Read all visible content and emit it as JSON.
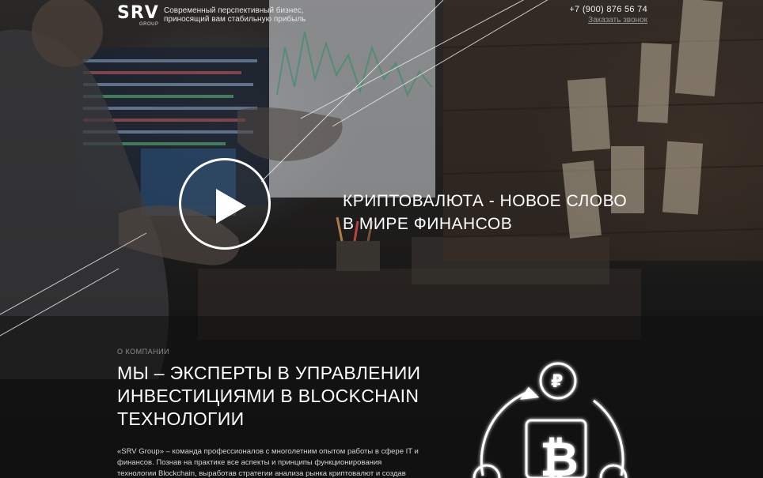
{
  "header": {
    "logo": "SRV",
    "logo_sub": "GROUP",
    "tagline": "Современный перспективный бизнес, приносящий вам стабильную прибыль",
    "phone": "+7 (900) 876 56 74",
    "callback": "Заказать звонок"
  },
  "hero": {
    "title": "КРИПТОВАЛЮТА - НОВОЕ СЛОВО В МИРЕ ФИНАНСОВ"
  },
  "about": {
    "label": "О КОМПАНИИ",
    "title": "МЫ – ЭКСПЕРТЫ В УПРАВЛЕНИИ ИНВЕСТИЦИЯМИ В BLOCKCHAIN ТЕХНОЛОГИИ",
    "text": "«SRV Group» – команда профессионалов с многолетним опытом работы в сфере IT и финансов. Познав на практике все аспекты и принципы функционирования технологии Blockchain, выработав стратегии анализа рынка криптовалют и создав"
  },
  "icons": {
    "play": "play-icon",
    "crypto": "crypto-coins-icon"
  },
  "colors": {
    "background": "#141414",
    "text": "#ffffff",
    "muted": "#8c8c8c"
  }
}
